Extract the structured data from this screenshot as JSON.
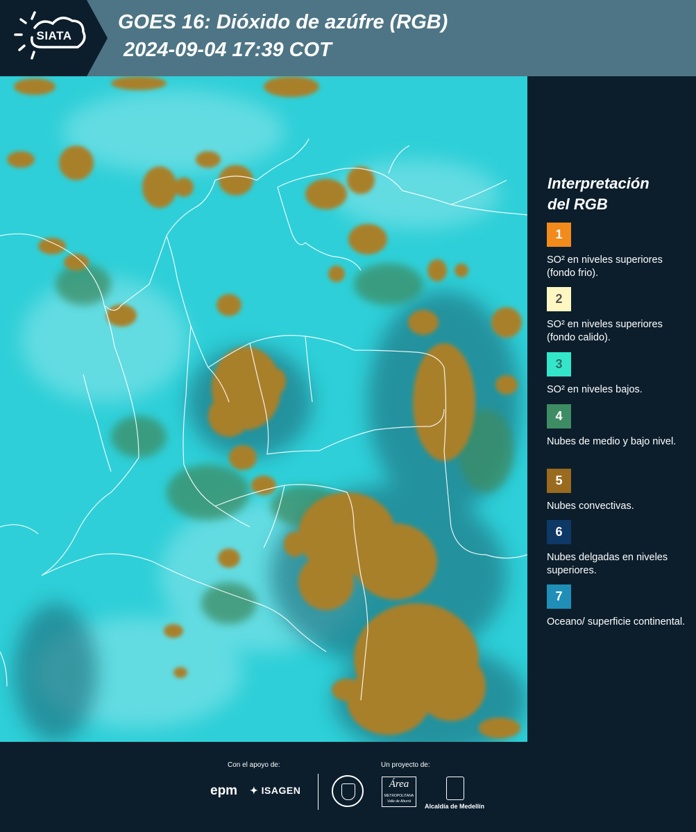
{
  "header": {
    "logo_text": "SIATA",
    "title_line1": "GOES 16: Dióxido de azúfre (RGB)",
    "title_line2": "2024-09-04 17:39 COT"
  },
  "legend": {
    "title_line1": "Interpretación",
    "title_line2": "del RGB",
    "items": [
      {
        "number": "1",
        "color": "#f28a1c",
        "text_color": "#ffffff",
        "text": "SO² en niveles superiores (fondo frio)."
      },
      {
        "number": "2",
        "color": "#fff7c2",
        "text_color": "#555555",
        "text": "SO² en niveles superiores (fondo calido)."
      },
      {
        "number": "3",
        "color": "#33e6c9",
        "text_color": "#2f6f66",
        "text": "SO² en niveles bajos."
      },
      {
        "number": "4",
        "color": "#3e8c63",
        "text_color": "#ffffff",
        "text": "Nubes de medio y bajo nivel."
      },
      {
        "number": "5",
        "color": "#9a6a1e",
        "text_color": "#ffffff",
        "text": "Nubes convectivas."
      },
      {
        "number": "6",
        "color": "#0e3866",
        "text_color": "#ffffff",
        "text": "Nubes delgadas en niveles superiores."
      },
      {
        "number": "7",
        "color": "#1f8fb8",
        "text_color": "#ffffff",
        "text": "Oceano/ superficie continental."
      }
    ]
  },
  "footer": {
    "support_label": "Con el apoyo de:",
    "project_label": "Un proyecto de:",
    "sponsor_epm": "epm",
    "sponsor_isagen": "ISAGEN",
    "metro_name": "Área",
    "metro_sub1": "METROPOLITANA",
    "metro_sub2": "Valle de Aburrá",
    "alcaldia": "Alcaldía de Medellín"
  },
  "colors": {
    "header_bg": "#4e7585",
    "dark_bg": "#0c1e2c",
    "map_background": "#2ecfd8",
    "cloud_convective": "#a9802b"
  }
}
